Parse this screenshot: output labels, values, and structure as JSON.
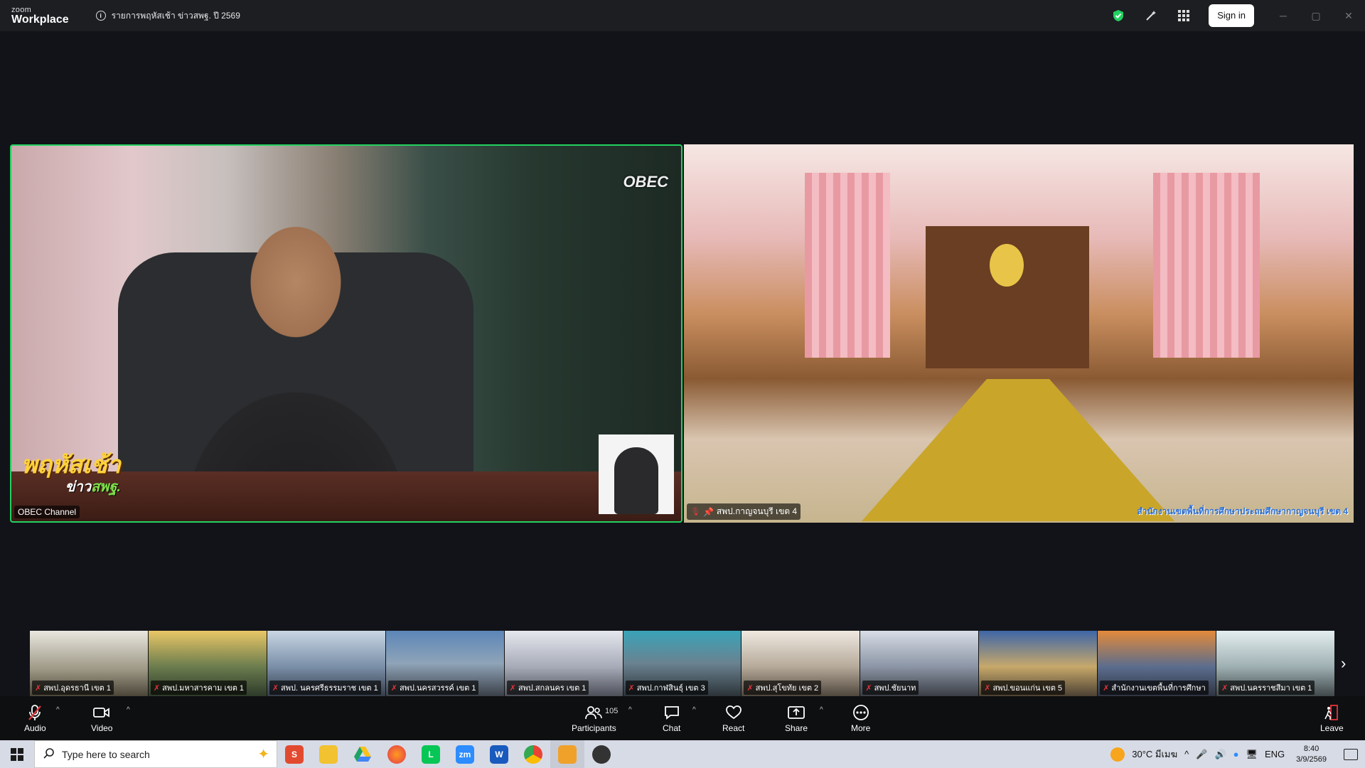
{
  "titlebar": {
    "logo_line1": "zoom",
    "logo_line2": "Workplace",
    "meeting_title": "รายการพฤหัสเช้า ข่าวสพฐ. ปี 2569",
    "signin_label": "Sign in"
  },
  "main_videos": [
    {
      "name": "OBEC Channel",
      "channel_logo": "OBEC",
      "show_logo_main": "พฤหัสเช้า",
      "show_logo_sub": "ข่าว",
      "show_logo_sub_accent": "สพฐ.",
      "muted": false,
      "active_speaker": true
    },
    {
      "name": "สพป.กาญจนบุรี เขต 4",
      "caption": "สำนักงานเขตพื้นที่การศึกษาประถมศึกษากาญจนบุรี เขต 4",
      "muted": true,
      "pinned": true
    }
  ],
  "thumbnails": [
    {
      "name": "สพป.อุดรธานี เขต 1",
      "muted": true
    },
    {
      "name": "สพป.มหาสารคาม เขต 1",
      "muted": true
    },
    {
      "name": "สพป. นครศรีธรรมราช เขต 1",
      "muted": true
    },
    {
      "name": "สพป.นครสวรรค์ เขต 1",
      "muted": true
    },
    {
      "name": "สพป.สกลนคร เขต 1",
      "muted": true
    },
    {
      "name": "สพป.กาฬสินธุ์ เขต 3",
      "muted": true
    },
    {
      "name": "สพป.สุโขทัย เขต 2",
      "muted": true
    },
    {
      "name": "สพป.ชัยนาท",
      "muted": true
    },
    {
      "name": "สพป.ขอนแก่น เขต 5",
      "muted": true
    },
    {
      "name": "สำนักงานเขตพื้นที่การศึกษา",
      "muted": true
    },
    {
      "name": "สพป.นครราชสีมา เขต 1",
      "muted": true
    }
  ],
  "toolbar": {
    "audio_label": "Audio",
    "video_label": "Video",
    "participants_label": "Participants",
    "participants_count": "105",
    "chat_label": "Chat",
    "react_label": "React",
    "share_label": "Share",
    "more_label": "More",
    "leave_label": "Leave"
  },
  "taskbar": {
    "search_placeholder": "Type here to search",
    "weather": "30°C มีเมฆ",
    "language": "ENG",
    "time": "8:40",
    "date": "3/9/2569"
  },
  "colors": {
    "active_border": "#23d160",
    "mute_red": "#e3353b",
    "toolbar_bg": "#0e0f11",
    "stage_bg": "#111318"
  }
}
